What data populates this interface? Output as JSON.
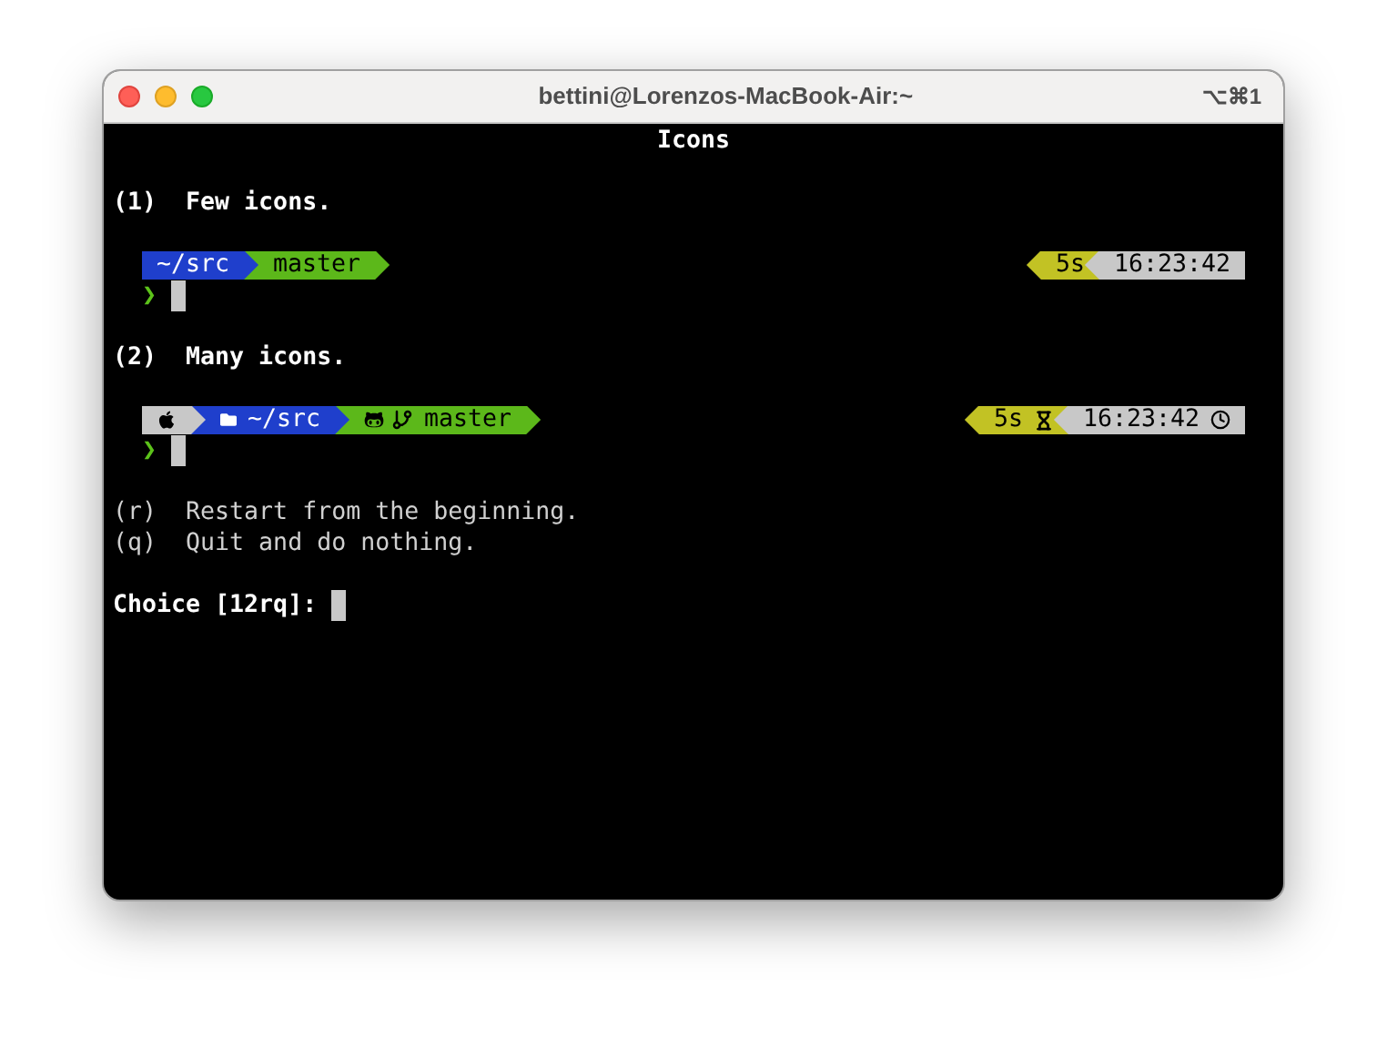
{
  "window": {
    "title": "bettini@Lorenzos-MacBook-Air:~",
    "shortcut": "⌥⌘1"
  },
  "terminal": {
    "heading": "Icons",
    "options": [
      {
        "label": "(1)  Few icons.",
        "icons": false,
        "prompt_char": "❯",
        "left": [
          {
            "kind": "dir",
            "text": "~/src",
            "color": "#1f3fcc"
          },
          {
            "kind": "vcs",
            "text": "master",
            "color": "#5cb81a"
          }
        ],
        "right": [
          {
            "kind": "duration",
            "text": "5s",
            "color": "#c2c224"
          },
          {
            "kind": "time",
            "text": "16:23:42",
            "color": "#c8c8c8"
          }
        ]
      },
      {
        "label": "(2)  Many icons.",
        "icons": true,
        "prompt_char": "❯",
        "left": [
          {
            "kind": "os",
            "color": "#c8c8c8"
          },
          {
            "kind": "dir",
            "text": "~/src",
            "color": "#1f3fcc"
          },
          {
            "kind": "vcs",
            "text": "master",
            "color": "#5cb81a"
          }
        ],
        "right": [
          {
            "kind": "duration",
            "text": "5s",
            "color": "#c2c224"
          },
          {
            "kind": "time",
            "text": "16:23:42",
            "color": "#c8c8c8"
          }
        ]
      }
    ],
    "menu": [
      "(r)  Restart from the beginning.",
      "(q)  Quit and do nothing."
    ],
    "prompt": "Choice [12rq]:"
  }
}
